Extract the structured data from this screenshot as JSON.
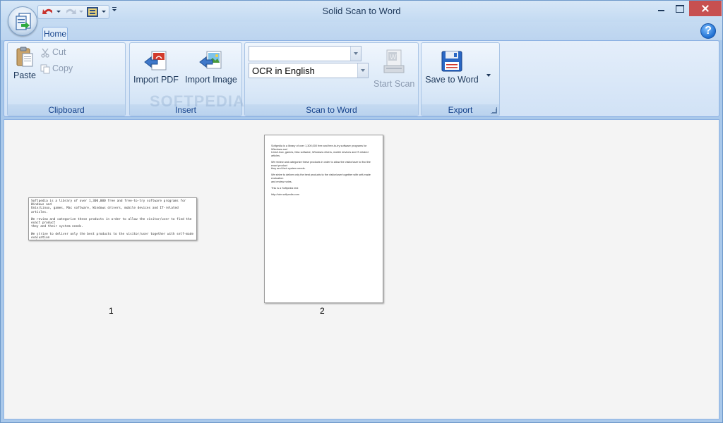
{
  "window": {
    "title": "Solid Scan to Word"
  },
  "tabs": [
    {
      "label": "Home",
      "active": true
    }
  ],
  "ribbon": {
    "clipboard": {
      "label": "Clipboard",
      "paste": "Paste",
      "cut": "Cut",
      "copy": "Copy"
    },
    "insert": {
      "label": "Insert",
      "import_pdf": "Import PDF",
      "import_image": "Import Image"
    },
    "scan": {
      "label": "Scan to Word",
      "scanner_select": "",
      "ocr_language": "OCR in English",
      "start_scan": "Start Scan"
    },
    "export": {
      "label": "Export",
      "save_to_word": "Save to Word"
    }
  },
  "pages": [
    {
      "number": "1",
      "text": "Softpedia is a library of over 1,300,000 free and free-to-try software programs for Windows and\nUnix/Linux, games, Mac software, Windows drivers, mobile devices and IT-related articles.\n\nWe review and categorize these products in order to allow the visitor/user to find the exact product\nthey and their system needs.\n\nWe strive to deliver only the best products to the visitor/user together with self-made evaluation\nand review notes.\n\nwww.win.softpedia.com"
    },
    {
      "number": "2",
      "text": "Softpedia is a library of over 1,300,000 free and free-to-try software programs for Windows and\nUnix/Linux, games, Mac software, Windows drivers, mobile devices and IT-related articles.\n\nWe review and categorize these products in order to allow the visitor/user to find the exact product\nthey and their system needs.\n\nWe strive to deliver only the best products to the visitor/user together with self-made evaluation\nand review notes.\n\nThis is a Softpedia test\n\nhttp://win.softpedia.com"
    }
  ],
  "watermark": "SOFTPEDIA",
  "colors": {
    "title_bar": "#c3daf2",
    "ribbon": "#d1e2f6",
    "close_button": "#c75050",
    "content_bg": "#f4f4f4"
  }
}
